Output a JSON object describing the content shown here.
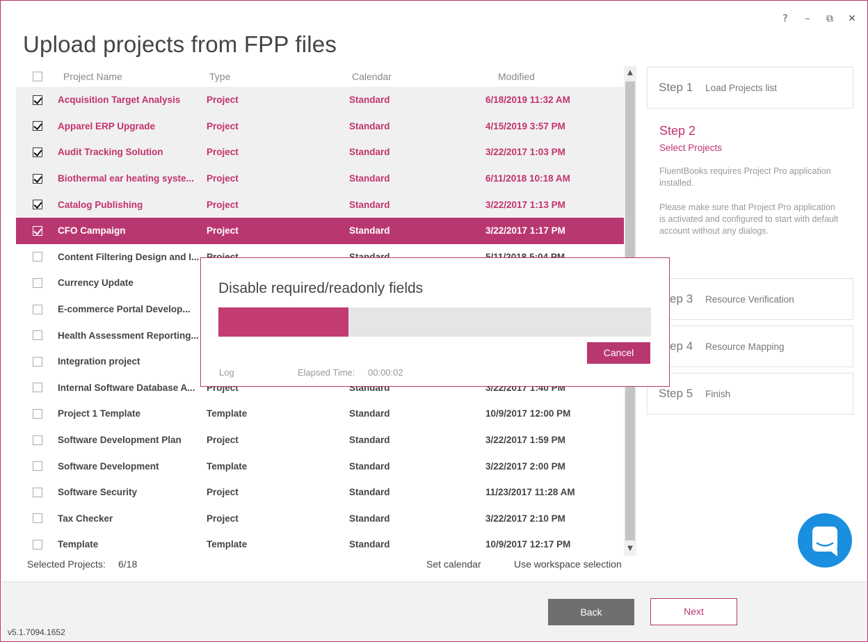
{
  "window_controls": [
    "?",
    "–",
    "⧉",
    "✕"
  ],
  "title": "Upload projects from FPP files",
  "table": {
    "headers": {
      "name": "Project Name",
      "type": "Type",
      "calendar": "Calendar",
      "modified": "Modified"
    },
    "rows": [
      {
        "name": "Acquisition Target Analysis",
        "type": "Project",
        "calendar": "Standard",
        "modified": "6/18/2019 11:32 AM",
        "checked": true,
        "state": "checked"
      },
      {
        "name": "Apparel ERP Upgrade",
        "type": "Project",
        "calendar": "Standard",
        "modified": "4/15/2019 3:57 PM",
        "checked": true,
        "state": "checked"
      },
      {
        "name": "Audit Tracking Solution",
        "type": "Project",
        "calendar": "Standard",
        "modified": "3/22/2017 1:03 PM",
        "checked": true,
        "state": "checked"
      },
      {
        "name": "Biothermal ear heating syste...",
        "type": "Project",
        "calendar": "Standard",
        "modified": "6/11/2018 10:18 AM",
        "checked": true,
        "state": "checked"
      },
      {
        "name": "Catalog Publishing",
        "type": "Project",
        "calendar": "Standard",
        "modified": "3/22/2017 1:13 PM",
        "checked": true,
        "state": "checked"
      },
      {
        "name": "CFO Campaign",
        "type": "Project",
        "calendar": "Standard",
        "modified": "3/22/2017 1:17 PM",
        "checked": true,
        "state": "active"
      },
      {
        "name": "Content Filtering Design and I...",
        "type": "Project",
        "calendar": "Standard",
        "modified": "5/11/2018 5:04 PM",
        "checked": false,
        "state": "plain"
      },
      {
        "name": "Currency Update",
        "type": "",
        "calendar": "",
        "modified": "",
        "checked": false,
        "state": "plain"
      },
      {
        "name": "E-commerce Portal Develop...",
        "type": "",
        "calendar": "",
        "modified": "",
        "checked": false,
        "state": "plain"
      },
      {
        "name": "Health Assessment Reporting...",
        "type": "",
        "calendar": "",
        "modified": "",
        "checked": false,
        "state": "plain"
      },
      {
        "name": "Integration project",
        "type": "",
        "calendar": "",
        "modified": "",
        "checked": false,
        "state": "plain"
      },
      {
        "name": "Internal Software Database A...",
        "type": "Project",
        "calendar": "Standard",
        "modified": "3/22/2017 1:40 PM",
        "checked": false,
        "state": "plain"
      },
      {
        "name": "Project 1 Template",
        "type": "Template",
        "calendar": "Standard",
        "modified": "10/9/2017 12:00 PM",
        "checked": false,
        "state": "plain"
      },
      {
        "name": "Software Development Plan",
        "type": "Project",
        "calendar": "Standard",
        "modified": "3/22/2017 1:59 PM",
        "checked": false,
        "state": "plain"
      },
      {
        "name": "Software Development",
        "type": "Template",
        "calendar": "Standard",
        "modified": "3/22/2017 2:00 PM",
        "checked": false,
        "state": "plain"
      },
      {
        "name": "Software Security",
        "type": "Project",
        "calendar": "Standard",
        "modified": "11/23/2017 11:28 AM",
        "checked": false,
        "state": "plain"
      },
      {
        "name": "Tax Checker",
        "type": "Project",
        "calendar": "Standard",
        "modified": "3/22/2017 2:10 PM",
        "checked": false,
        "state": "plain"
      },
      {
        "name": "Template",
        "type": "Template",
        "calendar": "Standard",
        "modified": "10/9/2017 12:17 PM",
        "checked": false,
        "state": "plain"
      }
    ]
  },
  "footer": {
    "selected_label": "Selected Projects:",
    "selected_value": "6/18",
    "set_calendar": "Set calendar",
    "use_workspace": "Use workspace selection"
  },
  "steps": [
    {
      "num": "Step 1",
      "label": "Load Projects list"
    },
    {
      "num": "Step 2",
      "label": "Select Projects",
      "desc1": "FluentBooks requires Project Pro application installed.",
      "desc2": "Please make sure that Project Pro application is activated and configured to start with default account without any dialogs."
    },
    {
      "num": "Step 3",
      "label": "Resource Verification"
    },
    {
      "num": "Step 4",
      "label": "Resource Mapping"
    },
    {
      "num": "Step 5",
      "label": "Finish"
    }
  ],
  "modal": {
    "title": "Disable required/readonly fields",
    "progress": 0.3,
    "cancel": "Cancel",
    "log": "Log",
    "elapsed_label": "Elapsed Time:",
    "elapsed_value": "00:00:02"
  },
  "buttons": {
    "back": "Back",
    "next": "Next"
  },
  "version": "v5.1.7094.1652",
  "colors": {
    "accent": "#b93770",
    "chat": "#1a8fe0"
  }
}
